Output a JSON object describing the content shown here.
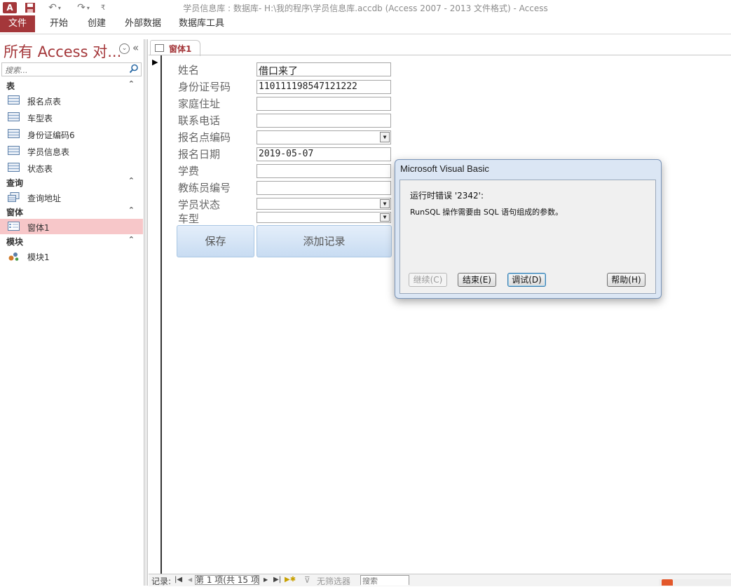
{
  "window": {
    "title": "学员信息库 : 数据库- H:\\我的程序\\学员信息库.accdb (Access 2007 - 2013 文件格式) - Access",
    "app_icon": "A",
    "qat": {
      "save_icon": "save-icon",
      "undo_icon": "undo-icon",
      "redo_icon": "redo-icon",
      "customize_icon": "customize-icon"
    }
  },
  "ribbon": {
    "tabs": [
      "文件",
      "开始",
      "创建",
      "外部数据",
      "数据库工具"
    ]
  },
  "nav": {
    "title": "所有 Access 对...",
    "search_placeholder": "搜索...",
    "groups": [
      {
        "label": "表",
        "items": [
          "报名点表",
          "车型表",
          "身份证编码6",
          "学员信息表",
          "状态表"
        ]
      },
      {
        "label": "查询",
        "items": [
          "查询地址"
        ]
      },
      {
        "label": "窗体",
        "items": [
          "窗体1"
        ]
      },
      {
        "label": "模块",
        "items": [
          "模块1"
        ]
      }
    ],
    "selected": "窗体1",
    "collapse_glyph": "«",
    "menu_glyph": "⌄",
    "chevron_glyph": "⌃"
  },
  "doc_tab": {
    "label": "窗体1"
  },
  "form": {
    "fields": [
      {
        "label": "姓名",
        "value": "借口来了",
        "type": "text"
      },
      {
        "label": "身份证号码",
        "value": "110111198547121222",
        "type": "text"
      },
      {
        "label": "家庭住址",
        "value": "",
        "type": "text"
      },
      {
        "label": "联系电话",
        "value": "",
        "type": "text"
      },
      {
        "label": "报名点编码",
        "value": "",
        "type": "combo"
      },
      {
        "label": "报名日期",
        "value": "2019-05-07",
        "type": "text"
      },
      {
        "label": "学费",
        "value": "",
        "type": "text"
      },
      {
        "label": "教练员编号",
        "value": "",
        "type": "text"
      },
      {
        "label": "学员状态",
        "value": "",
        "type": "combo"
      },
      {
        "label": "车型",
        "value": "",
        "type": "combo"
      }
    ],
    "save_label": "保存",
    "add_label": "添加记录"
  },
  "dialog": {
    "title": "Microsoft Visual Basic",
    "error_line": "运行时错误 '2342':",
    "message": "RunSQL 操作需要由 SQL 语句组成的参数。",
    "buttons": {
      "continue": "继续(C)",
      "end": "结束(E)",
      "debug": "调试(D)",
      "help": "帮助(H)"
    }
  },
  "status": {
    "record_label": "记录:",
    "record_value": "第 1 项(共 15 项",
    "filter_label": "无筛选器",
    "search_placeholder": "搜索"
  }
}
